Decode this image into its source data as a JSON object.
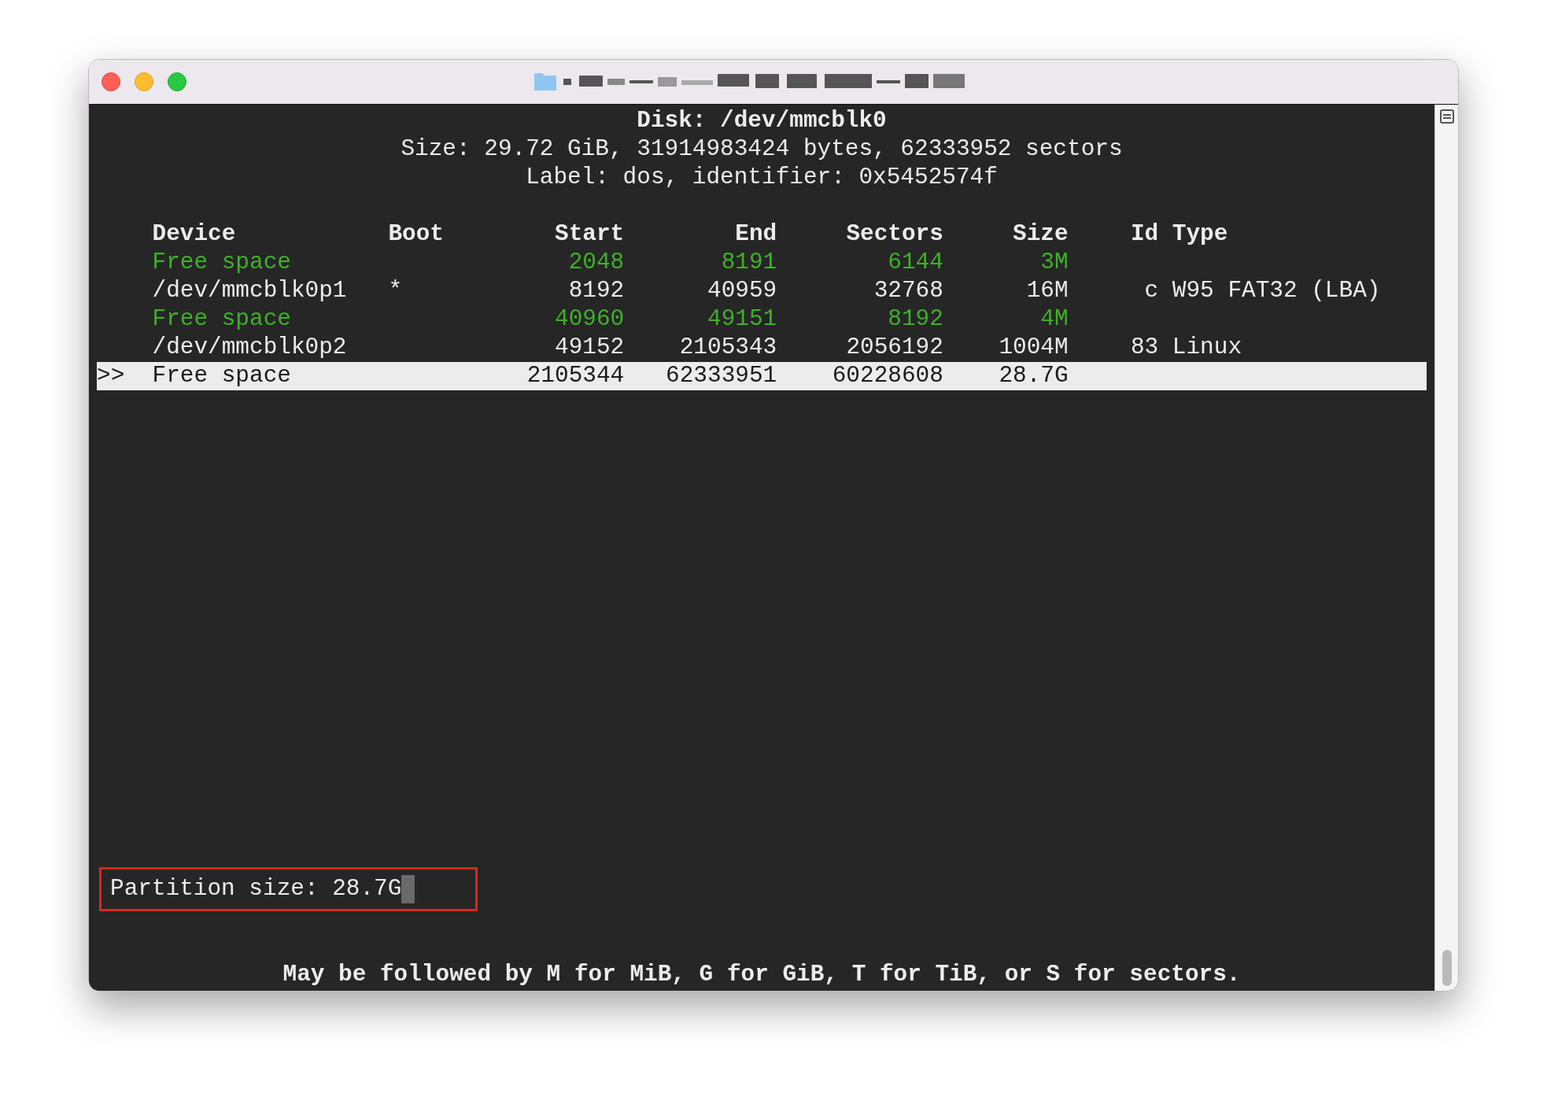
{
  "header": {
    "disk": "Disk: /dev/mmcblk0",
    "size": "Size: 29.72 GiB, 31914983424 bytes, 62333952 sectors",
    "label": "Label: dos, identifier: 0x5452574f"
  },
  "table": {
    "columns": [
      "Device",
      "Boot",
      "Start",
      "End",
      "Sectors",
      "Size",
      "Id",
      "Type"
    ],
    "rows": [
      {
        "kind": "free",
        "selected": false,
        "device": "Free space",
        "start": "2048",
        "end": "8191",
        "sectors": "6144",
        "size": "3M"
      },
      {
        "kind": "partition",
        "selected": false,
        "device": "/dev/mmcblk0p1",
        "boot": "*",
        "start": "8192",
        "end": "40959",
        "sectors": "32768",
        "size": "16M",
        "id": "c",
        "type": "W95 FAT32 (LBA)"
      },
      {
        "kind": "free",
        "selected": false,
        "device": "Free space",
        "start": "40960",
        "end": "49151",
        "sectors": "8192",
        "size": "4M"
      },
      {
        "kind": "partition",
        "selected": false,
        "device": "/dev/mmcblk0p2",
        "start": "49152",
        "end": "2105343",
        "sectors": "2056192",
        "size": "1004M",
        "id": "83",
        "type": "Linux"
      },
      {
        "kind": "free",
        "selected": true,
        "marker": ">>",
        "device": "Free space",
        "start": "2105344",
        "end": "62333951",
        "sectors": "60228608",
        "size": "28.7G"
      }
    ]
  },
  "prompt": {
    "label": "Partition size:",
    "value": "28.7G"
  },
  "hint": "May be followed by M for MiB, G for GiB, T for TiB, or S for sectors."
}
